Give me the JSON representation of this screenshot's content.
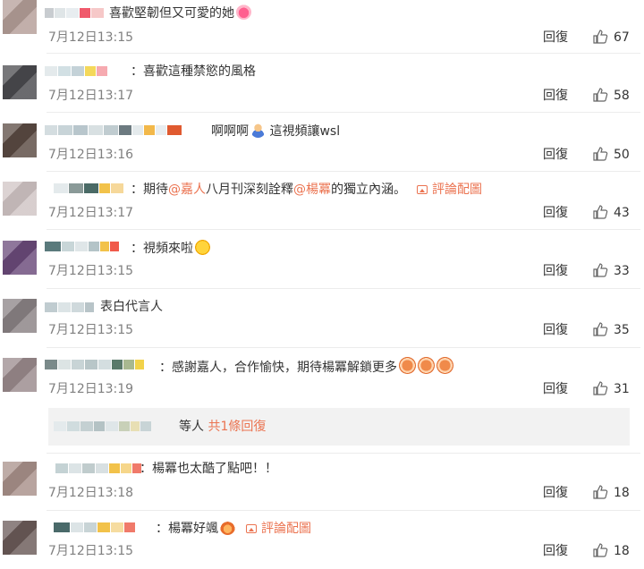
{
  "comments": [
    {
      "text_parts": [
        "喜歡堅韌但又可愛的她"
      ],
      "emoji": "heart-emoji",
      "time": "7月12日13:15",
      "reply": "回復",
      "likes": "67"
    },
    {
      "text_parts": [
        "：喜歡這種禁慾的風格"
      ],
      "time": "7月12日13:17",
      "reply": "回復",
      "likes": "58"
    },
    {
      "text_parts": [
        "啊啊啊",
        "這視頻讓wsl"
      ],
      "emoji": "person-emoji",
      "time": "7月12日13:16",
      "reply": "回復",
      "likes": "50"
    },
    {
      "prefix": "：期待",
      "mention1": "@嘉人",
      "middle": "八月刊深刻詮釋",
      "mention2": "@楊冪",
      "suffix": "的獨立內涵。",
      "image_link": "評論配圖",
      "time": "7月12日13:17",
      "reply": "回復",
      "likes": "43"
    },
    {
      "text_parts": [
        "：視頻來啦"
      ],
      "emoji": "shocked-face-emoji",
      "time": "7月12日13:15",
      "reply": "回復",
      "likes": "33"
    },
    {
      "text_parts": [
        "表白代言人"
      ],
      "time": "7月12日13:15",
      "reply": "回復",
      "likes": "35"
    },
    {
      "text_parts": [
        "：感謝嘉人，合作愉快，期待楊冪解鎖更多"
      ],
      "emoji": "monkey-emoji",
      "time": "7月12日13:19",
      "reply": "回復",
      "likes": "31"
    },
    {
      "text_parts": [
        "：楊冪也太酷了點吧！！"
      ],
      "time": "7月12日13:18",
      "reply": "回復",
      "likes": "18"
    },
    {
      "text_parts": [
        "：楊冪好颯"
      ],
      "emoji": "flame-face-emoji",
      "image_link": "評論配圖",
      "time": "7月12日13:15",
      "reply": "回復",
      "likes": "18"
    }
  ],
  "subreply": {
    "suffix": "等人",
    "link": "共1條回復"
  },
  "colors": {
    "link": "#eb7350",
    "meta": "#808080",
    "text": "#333333",
    "subreply_bg": "#f2f2f2"
  }
}
